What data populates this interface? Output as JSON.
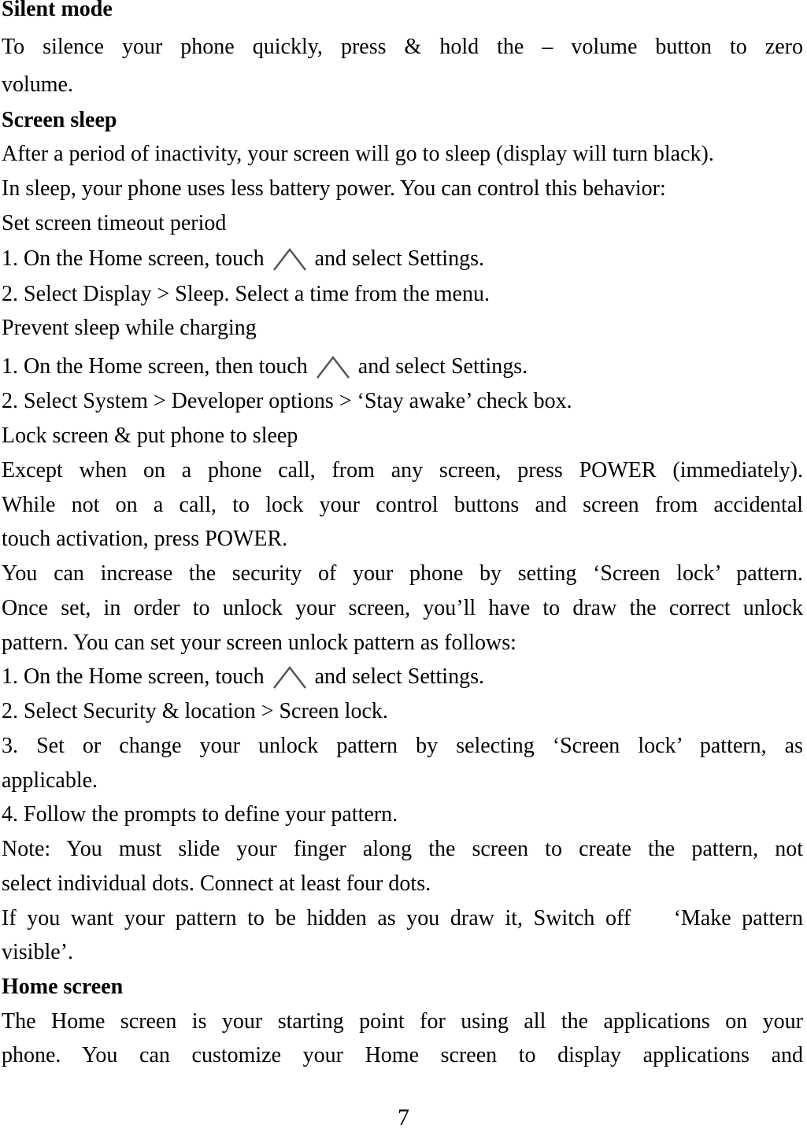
{
  "sections": {
    "silent_mode": {
      "heading": "Silent mode",
      "lines": [
        "To silence your phone quickly, press & hold the – volume button to zero",
        "volume."
      ]
    },
    "screen_sleep": {
      "heading": "Screen sleep",
      "lines": [
        "After a period of inactivity, your screen will go to sleep (display will turn black).",
        "In sleep, your phone uses less battery power. You can control this behavior:"
      ],
      "timeout": {
        "title": "Set screen timeout period",
        "step1_before": "1. On the Home screen, touch",
        "step1_after": "and select Settings.",
        "step2": "2. Select Display > Sleep. Select a time from the menu."
      },
      "charging": {
        "title": "Prevent sleep while charging",
        "step1_before": "1. On the Home screen, then touch",
        "step1_after": "and select Settings.",
        "step2": "2. Select System > Developer options > ‘Stay awake’ check box."
      },
      "lock": {
        "title": "Lock screen & put phone to sleep",
        "lines": [
          "Except when on a phone call, from any screen, press POWER (immediately).",
          "While not on a call, to lock your control buttons and screen from accidental",
          "touch activation, press POWER.",
          "You can increase the security of your phone by setting ‘Screen lock’ pattern.",
          "Once set, in order to unlock your screen, you’ll have to draw the correct unlock",
          "pattern. You can set your screen unlock pattern as follows:"
        ],
        "step1_before": "1. On the Home screen, touch",
        "step1_after": "and select Settings.",
        "step2": "2. Select Security & location > Screen lock.",
        "step3": [
          "3. Set or change your unlock pattern by selecting ‘Screen lock’ pattern, as",
          "applicable."
        ],
        "step4": "4. Follow the prompts to define your pattern.",
        "note": [
          "Note: You must slide your finger along the screen to create the pattern, not",
          "select individual dots. Connect at least four dots."
        ],
        "hidden": [
          "If you want your pattern to be hidden as you draw it, Switch off    ‘Make pattern",
          "visible’."
        ]
      }
    },
    "home_screen": {
      "heading": "Home screen",
      "lines": [
        "The Home screen is your starting point for using all the applications on your",
        "phone. You can customize your Home screen to display applications and"
      ]
    }
  },
  "icons": {
    "launcher": "up-chevron-icon"
  },
  "page_number": "7"
}
